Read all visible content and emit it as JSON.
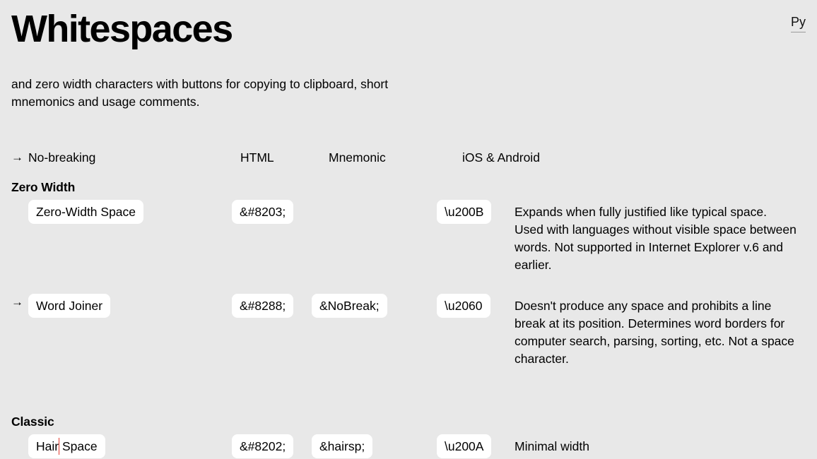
{
  "header": {
    "title": "Whitespaces",
    "lang_label": "Py",
    "subtitle": "and zero width characters with buttons for copying to clipboard, short mnemonics and usage comments."
  },
  "table": {
    "columns": {
      "arrow": "→",
      "name": "No-breaking",
      "html": "HTML",
      "mnemonic": "Mnemonic",
      "platform": "iOS & Android"
    },
    "sections": [
      {
        "title": "Zero Width",
        "rows": [
          {
            "no_break": false,
            "name": "Zero-Width Space",
            "html": "&#8203;",
            "mnemonic": "",
            "unicode": "\\u200B",
            "description": "Expands when fully justified like typical space. Used with languages without visible space between words. Not supported in Internet Explorer v.6 and earlier."
          },
          {
            "no_break": true,
            "name": "Word Joiner",
            "html": "&#8288;",
            "mnemonic": "&NoBreak;",
            "unicode": "\\u2060",
            "description": "Doesn't produce any space and prohibits a line break at its position. Determines word borders for computer search, parsing, sorting, etc. Not a space character."
          }
        ]
      },
      {
        "title": "Classic",
        "rows": [
          {
            "no_break": false,
            "name": "Hair Space",
            "name_caret_after": "Hair",
            "html": "&#8202;",
            "mnemonic": "&hairsp;",
            "unicode": "\\u200A",
            "description": "Minimal width"
          }
        ]
      }
    ]
  },
  "colors": {
    "background": "#e8e8e8",
    "pill": "#ffffff",
    "text": "#000000",
    "caret": "#e23b2e"
  }
}
